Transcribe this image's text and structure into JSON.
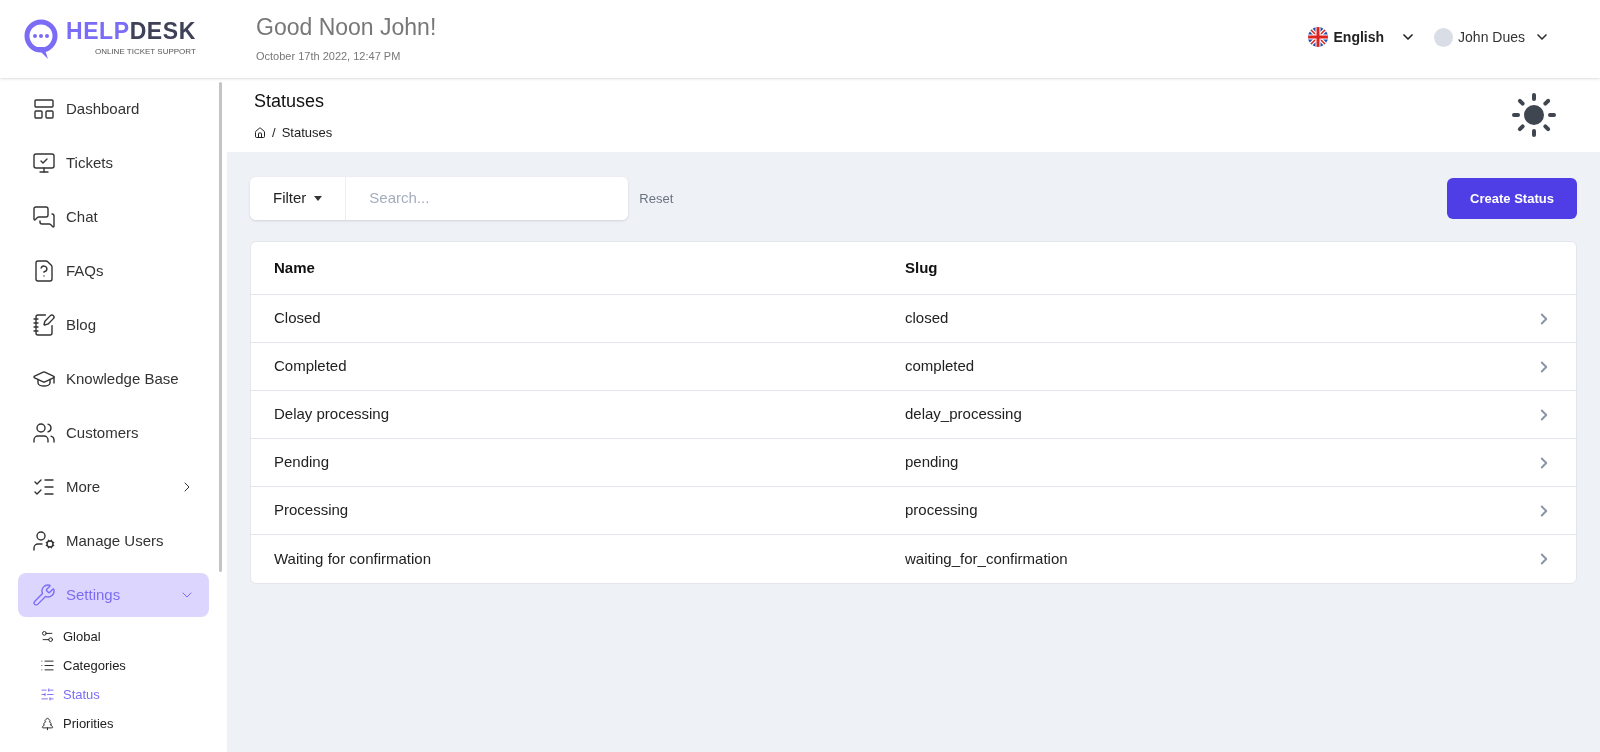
{
  "logo": {
    "name_parts": [
      "HELP",
      "DESK"
    ],
    "tagline": "ONLINE TICKET SUPPORT"
  },
  "header": {
    "greeting": "Good Noon John!",
    "datetime": "October 17th 2022, 12:47 PM",
    "language": "English",
    "user": "John Dues"
  },
  "sidebar": {
    "items": [
      {
        "label": "Dashboard",
        "selected": false
      },
      {
        "label": "Tickets",
        "selected": false
      },
      {
        "label": "Chat",
        "selected": false
      },
      {
        "label": "FAQs",
        "selected": false
      },
      {
        "label": "Blog",
        "selected": false
      },
      {
        "label": "Knowledge Base",
        "selected": false
      },
      {
        "label": "Customers",
        "selected": false
      },
      {
        "label": "More",
        "selected": false,
        "expanded": false
      },
      {
        "label": "Manage Users",
        "selected": false
      },
      {
        "label": "Settings",
        "selected": true,
        "expanded": true,
        "children": [
          {
            "label": "Global",
            "selected": false
          },
          {
            "label": "Categories",
            "selected": false
          },
          {
            "label": "Status",
            "selected": true
          },
          {
            "label": "Priorities",
            "selected": false
          }
        ]
      }
    ]
  },
  "page": {
    "title": "Statuses",
    "breadcrumb_separator": "/",
    "breadcrumb": [
      "Statuses"
    ]
  },
  "toolbar": {
    "filter": "Filter",
    "search_placeholder": "Search...",
    "reset": "Reset",
    "create": "Create Status"
  },
  "table": {
    "columns": [
      "Name",
      "Slug"
    ],
    "rows": [
      {
        "name": "Closed",
        "slug": "closed"
      },
      {
        "name": "Completed",
        "slug": "completed"
      },
      {
        "name": "Delay processing",
        "slug": "delay_processing"
      },
      {
        "name": "Pending",
        "slug": "pending"
      },
      {
        "name": "Processing",
        "slug": "processing"
      },
      {
        "name": "Waiting for confirmation",
        "slug": "waiting_for_confirmation"
      }
    ]
  }
}
